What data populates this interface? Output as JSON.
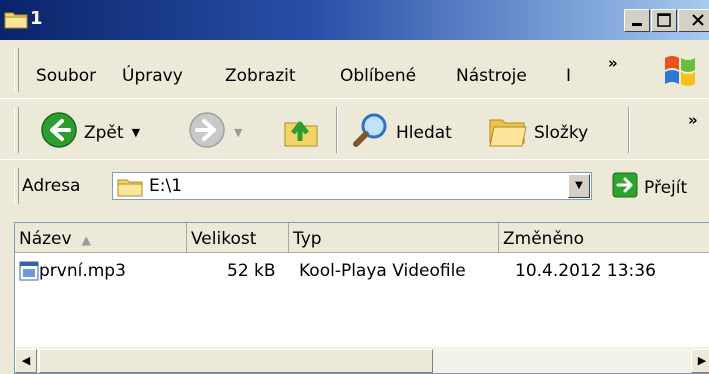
{
  "window": {
    "title": "1"
  },
  "menu": {
    "items": [
      "Soubor",
      "Úpravy",
      "Zobrazit",
      "Oblíbené",
      "Nástroje",
      "I"
    ],
    "overflow": "»"
  },
  "toolbar": {
    "back_label": "Zpět",
    "search_label": "Hledat",
    "folders_label": "Složky",
    "overflow": "»"
  },
  "address": {
    "label": "Adresa",
    "value": "E:\\1",
    "go_label": "Přejít"
  },
  "columns": [
    "Název",
    "Velikost",
    "Typ",
    "Změněno"
  ],
  "files": [
    {
      "name": "první.mp3",
      "size": "52 kB",
      "type": "Kool-Playa Videofile",
      "modified": "10.4.2012 13:36"
    }
  ],
  "colors": {
    "title_start": "#0A246A",
    "title_end": "#A6CAF0",
    "chrome": "#ECE9D8",
    "back_green": "#2E9C2E",
    "go_green": "#2EA52E"
  },
  "icons": {
    "title": "folder-icon",
    "back": "back-arrow-icon",
    "forward": "forward-arrow-icon",
    "up": "folder-up-icon",
    "search": "magnifier-icon",
    "folders": "folders-icon",
    "go": "go-arrow-icon",
    "file": "media-file-icon"
  }
}
